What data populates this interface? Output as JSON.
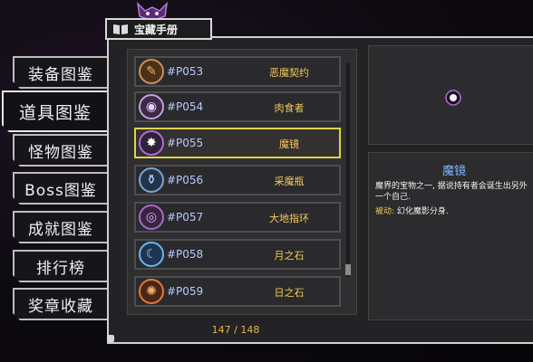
{
  "header": {
    "title": "宝藏手册",
    "book_icon": "book-icon"
  },
  "tabs": [
    {
      "label": "装备图鉴",
      "active": false
    },
    {
      "label": "道具图鉴",
      "active": true
    },
    {
      "label": "怪物图鉴",
      "active": false
    },
    {
      "label": "Boss图鉴",
      "active": false
    },
    {
      "label": "成就图鉴",
      "active": false
    },
    {
      "label": "排行榜",
      "active": false
    },
    {
      "label": "奖章收藏",
      "active": false
    }
  ],
  "items": [
    {
      "code": "#P053",
      "name": "恶魔契约",
      "icon": "scroll-icon",
      "selected": false
    },
    {
      "code": "#P054",
      "name": "肉食者",
      "icon": "eye-icon",
      "selected": false
    },
    {
      "code": "#P055",
      "name": "魔镜",
      "icon": "mirror-icon",
      "selected": true
    },
    {
      "code": "#P056",
      "name": "采魔瓶",
      "icon": "bottle-icon",
      "selected": false
    },
    {
      "code": "#P057",
      "name": "大地指环",
      "icon": "ring-icon",
      "selected": false
    },
    {
      "code": "#P058",
      "name": "月之石",
      "icon": "moon-stone-icon",
      "selected": false
    },
    {
      "code": "#P059",
      "name": "日之石",
      "icon": "sun-stone-icon",
      "selected": false
    }
  ],
  "counter": "147 / 148",
  "detail": {
    "title": "魔镜",
    "description": "魔界的宝物之一, 据说持有者会诞生出另外一个自己.",
    "skill_label": "被动:",
    "skill_text": " 幻化魔影分身."
  },
  "colors": {
    "selected_border": "#e0d24e",
    "name_text": "#f1c85a",
    "code_text": "#b8c8ff"
  }
}
